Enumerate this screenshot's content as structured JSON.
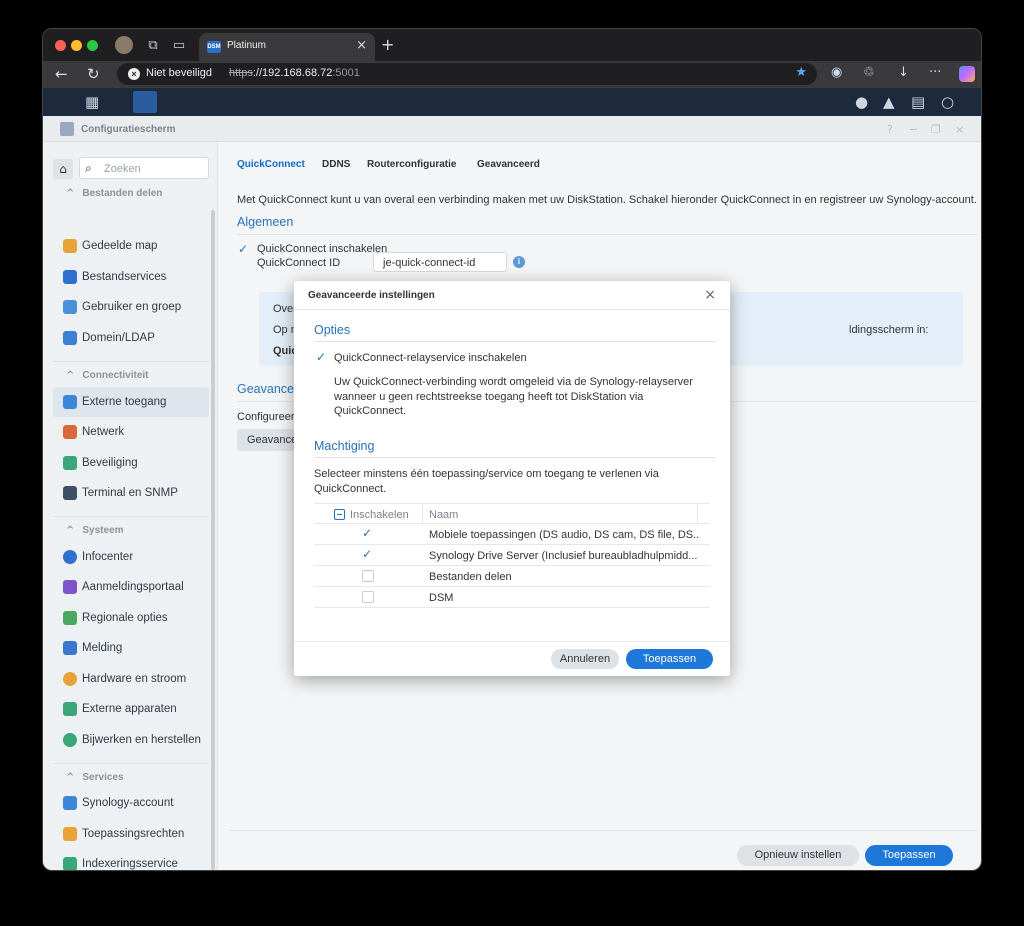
{
  "browser": {
    "tab_title": "Platinum",
    "favicon_text": "DSM",
    "security_warning": "Niet beveiligd",
    "url_scheme": "https",
    "url_host": "://192.168.68.72",
    "url_port": ":5001"
  },
  "window": {
    "title": "Configuratiescherm"
  },
  "sidebar": {
    "search_placeholder": "Zoeken",
    "sections": [
      {
        "label": "Bestanden delen"
      },
      {
        "label": "Connectiviteit"
      },
      {
        "label": "Systeem"
      },
      {
        "label": "Services"
      }
    ],
    "items": [
      {
        "label": "Gedeelde map",
        "color": "#e8a23a"
      },
      {
        "label": "Bestandservices",
        "color": "#2e6fcf"
      },
      {
        "label": "Gebruiker en groep",
        "color": "#4a8fd8"
      },
      {
        "label": "Domein/LDAP",
        "color": "#3c7fd4"
      },
      {
        "label": "Externe toegang",
        "color": "#3a86d8"
      },
      {
        "label": "Netwerk",
        "color": "#d6683a"
      },
      {
        "label": "Beveiliging",
        "color": "#3aa67a"
      },
      {
        "label": "Terminal en SNMP",
        "color": "#3c4f66"
      },
      {
        "label": "Infocenter",
        "color": "#2e6fcf"
      },
      {
        "label": "Aanmeldingsportaal",
        "color": "#7b55c9"
      },
      {
        "label": "Regionale opties",
        "color": "#4aa860"
      },
      {
        "label": "Melding",
        "color": "#3a78d0"
      },
      {
        "label": "Hardware en stroom",
        "color": "#e8a23a"
      },
      {
        "label": "Externe apparaten",
        "color": "#3aa67a"
      },
      {
        "label": "Bijwerken en herstellen",
        "color": "#3aa67a"
      },
      {
        "label": "Synology-account",
        "color": "#3a86d8"
      },
      {
        "label": "Toepassingsrechten",
        "color": "#e8a23a"
      },
      {
        "label": "Indexeringsservice",
        "color": "#3aa67a"
      }
    ]
  },
  "main": {
    "tabs": [
      {
        "label": "QuickConnect"
      },
      {
        "label": "DDNS"
      },
      {
        "label": "Routerconfiguratie"
      },
      {
        "label": "Geavanceerd"
      }
    ],
    "description": "Met QuickConnect kunt u van overal een verbinding maken met uw DiskStation. Schakel hieronder QuickConnect in en registreer uw Synology-account.",
    "general_heading": "Algemeen",
    "enable_label": "QuickConnect inschakelen",
    "id_label": "QuickConnect ID",
    "id_value": "je-quick-connect-id",
    "info_over": "Over",
    "info_op": "Op n",
    "info_quic": "Quic",
    "info_right": "ldingsscherm in:",
    "advanced_heading": "Geavancee",
    "configure_text": "Configureer",
    "advanced_button": "Geavance",
    "reset_button": "Opnieuw instellen",
    "apply_button": "Toepassen"
  },
  "dialog": {
    "title": "Geavanceerde instellingen",
    "options_heading": "Opties",
    "relay_label": "QuickConnect-relayservice inschakelen",
    "relay_desc_1": "Uw QuickConnect-verbinding wordt omgeleid via de Synology-relayserver",
    "relay_desc_2": "wanneer u geen rechtstreekse toegang heeft tot DiskStation via",
    "relay_desc_3": "QuickConnect.",
    "permission_heading": "Machtiging",
    "permission_desc_1": "Selecteer minstens één toepassing/service om toegang te verlenen via",
    "permission_desc_2": "QuickConnect.",
    "table": {
      "col_enable": "Inschakelen",
      "col_name": "Naam",
      "rows": [
        {
          "name": "Mobiele toepassingen (DS audio, DS cam, DS file, DS...",
          "checked": true
        },
        {
          "name": "Synology Drive Server (Inclusief bureaubladhulpmidd...",
          "checked": true
        },
        {
          "name": "Bestanden delen",
          "checked": false
        },
        {
          "name": "DSM",
          "checked": false
        }
      ]
    },
    "cancel_button": "Annuleren",
    "apply_button": "Toepassen"
  }
}
